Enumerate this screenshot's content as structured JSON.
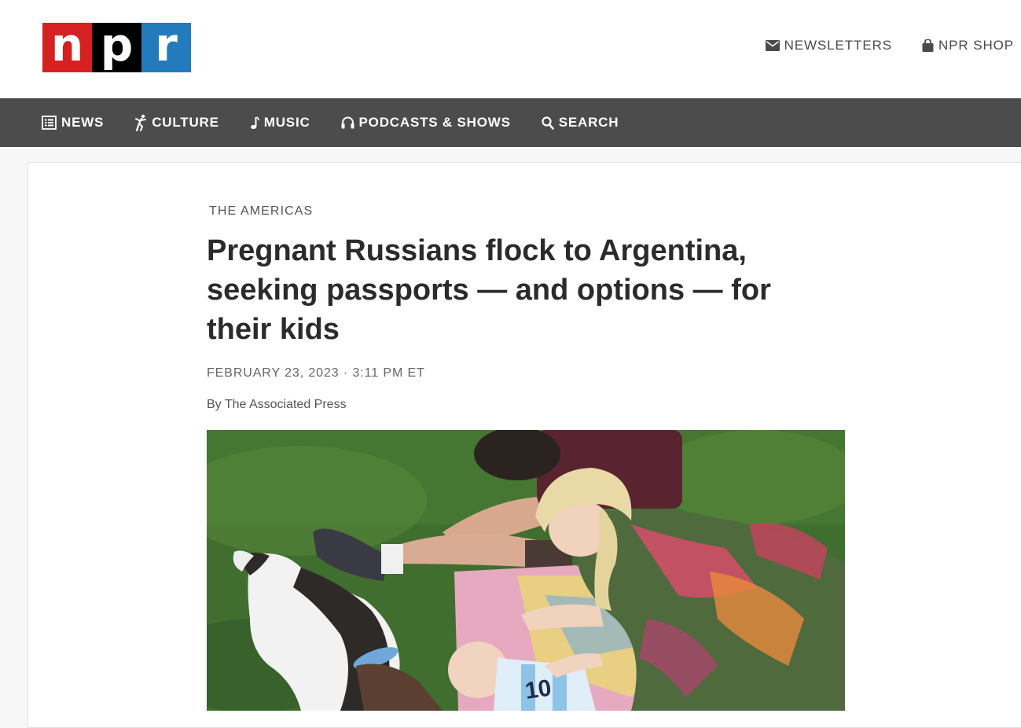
{
  "header": {
    "logo": {
      "letters": [
        "n",
        "p",
        "r"
      ],
      "colors": [
        "#d62021",
        "#000000",
        "#237bbd"
      ]
    },
    "utility_links": [
      {
        "label": "NEWSLETTERS",
        "icon": "envelope-icon"
      },
      {
        "label": "NPR SHOP",
        "icon": "shopping-bag-icon"
      }
    ]
  },
  "nav": {
    "items": [
      {
        "label": "NEWS",
        "icon": "list-icon"
      },
      {
        "label": "CULTURE",
        "icon": "dancer-icon"
      },
      {
        "label": "MUSIC",
        "icon": "music-note-icon"
      },
      {
        "label": "PODCASTS & SHOWS",
        "icon": "headphones-icon"
      },
      {
        "label": "SEARCH",
        "icon": "search-icon"
      }
    ],
    "background_color": "#4c4c4c"
  },
  "article": {
    "slug": "THE AMERICAS",
    "headline": "Pregnant Russians flock to Argentina, seeking passports — and options — for their kids",
    "date": "FEBRUARY 23, 2023 · 3:11 PM ET",
    "byline": "By The Associated Press",
    "photo_jersey_number": "10"
  }
}
